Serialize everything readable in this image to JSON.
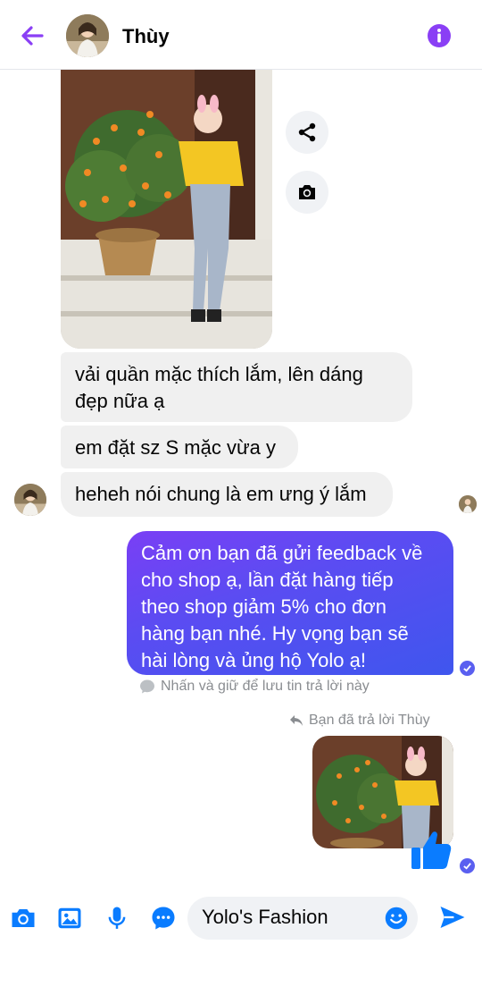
{
  "header": {
    "contact_name": "Thùy",
    "back_icon": "arrow-left-icon",
    "info_icon": "info-icon"
  },
  "actions": {
    "share_icon": "share-icon",
    "camera_icon": "camera-icon"
  },
  "messages": {
    "received": [
      "vải quần mặc thích lắm, lên dáng\nđẹp nữa ạ",
      "em đặt sz S mặc vừa y",
      "heheh nói chung là em ưng ý lắm"
    ],
    "sent": "Cảm ơn bạn đã gửi feedback về\ncho shop ạ, lần đặt hàng tiếp\ntheo shop giảm 5% cho đơn\nhàng bạn nhé. Hy vọng bạn sẽ\nhài lòng và ủng hộ Yolo ạ!",
    "hint": "Nhấn và giữ để lưu tin trả lời này",
    "reply_note": "Bạn đã trả lời Thùy"
  },
  "composer": {
    "input_value": "Yolo's Fashion",
    "icons": [
      "camera-icon",
      "gallery-icon",
      "microphone-icon",
      "chat-bubble-icon",
      "emoji-icon",
      "send-icon"
    ]
  },
  "colors": {
    "accent": "#8a3ff5",
    "messenger_blue": "#0a7cff",
    "bubble_in": "#f0f0f0",
    "text_muted": "#8a8d91"
  }
}
